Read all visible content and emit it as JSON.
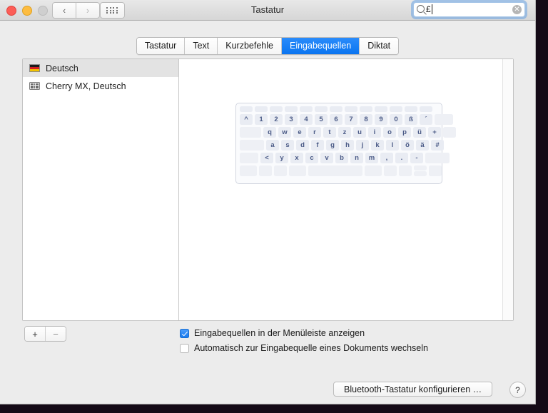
{
  "window": {
    "title": "Tastatur",
    "traffic_lights": [
      "close",
      "minimize",
      "zoom"
    ],
    "nav_back": "‹",
    "nav_forward": "›",
    "grid_button": "show-all-grid"
  },
  "search": {
    "value": "£",
    "icon": "search-icon",
    "clear": "✕"
  },
  "tabs": [
    {
      "label": "Tastatur",
      "active": false
    },
    {
      "label": "Text",
      "active": false
    },
    {
      "label": "Kurzbefehle",
      "active": false
    },
    {
      "label": "Eingabequellen",
      "active": true
    },
    {
      "label": "Diktat",
      "active": false
    }
  ],
  "input_sources": [
    {
      "label": "Deutsch",
      "icon": "german-flag-icon",
      "selected": true
    },
    {
      "label": "Cherry MX, Deutsch",
      "icon": "keyboard-icon",
      "selected": false
    }
  ],
  "add_remove": {
    "add": "+",
    "remove": "−"
  },
  "checkboxes": [
    {
      "label": "Eingabequellen in der Menüleiste anzeigen",
      "checked": true
    },
    {
      "label": "Automatisch zur Eingabequelle eines Dokuments wechseln",
      "checked": false
    }
  ],
  "bottom": {
    "bluetooth_button": "Bluetooth-Tastatur konfigurieren …",
    "help_button": "?"
  },
  "keyboard_preview": {
    "layout_name": "Deutsch QWERTZ",
    "rows": [
      {
        "id": "fn",
        "keys": [
          "",
          "",
          "",
          "",
          "",
          "",
          "",
          "",
          "",
          "",
          "",
          "",
          ""
        ]
      },
      {
        "id": "number",
        "keys": [
          "^",
          "1",
          "2",
          "3",
          "4",
          "5",
          "6",
          "7",
          "8",
          "9",
          "0",
          "ß",
          "´",
          ""
        ]
      },
      {
        "id": "top",
        "keys": [
          "",
          "q",
          "w",
          "e",
          "r",
          "t",
          "z",
          "u",
          "i",
          "o",
          "p",
          "ü",
          "+",
          ""
        ]
      },
      {
        "id": "home",
        "keys": [
          "",
          "a",
          "s",
          "d",
          "f",
          "g",
          "h",
          "j",
          "k",
          "l",
          "ö",
          "ä",
          "#",
          ""
        ]
      },
      {
        "id": "bottom",
        "keys": [
          "",
          "<",
          "y",
          "x",
          "c",
          "v",
          "b",
          "n",
          "m",
          ",",
          ".",
          "-",
          ""
        ]
      },
      {
        "id": "mods",
        "keys": [
          "",
          "",
          "",
          "",
          "",
          "",
          "",
          "",
          ""
        ]
      }
    ]
  },
  "colors": {
    "accent": "#0a74f0",
    "window_bg": "#ececec",
    "key_text": "#4a5a86",
    "key_bg": "#e9ecf3"
  }
}
